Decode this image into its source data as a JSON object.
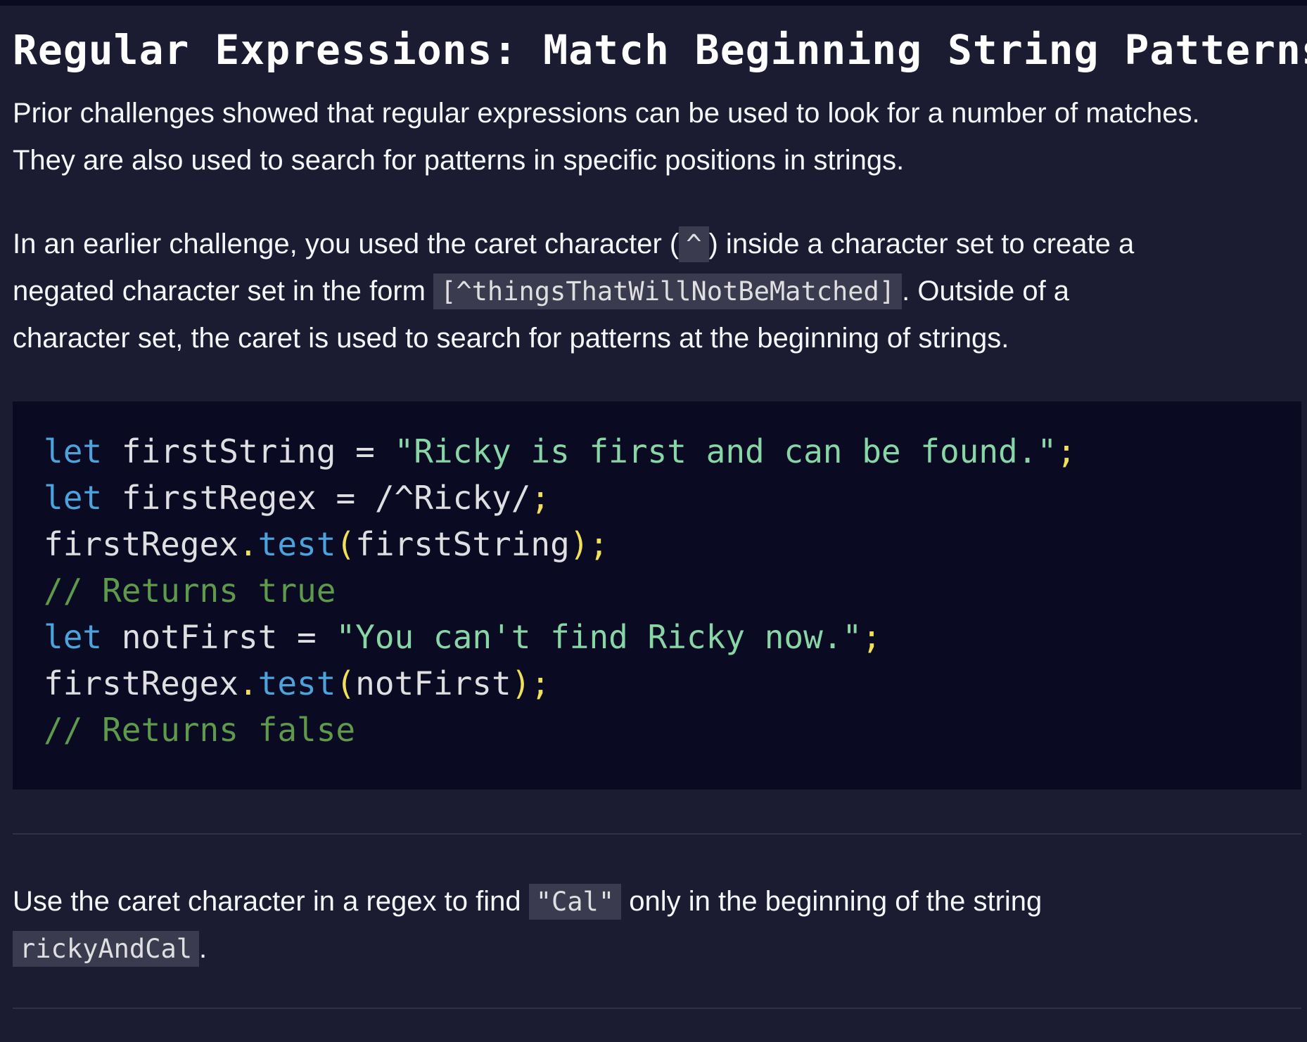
{
  "title": "Regular Expressions: Match Beginning String Patterns",
  "paragraph1": {
    "line1": "Prior challenges showed that regular expressions can be used to look for a number of matches.",
    "line2": "They are also used to search for patterns in specific positions in strings."
  },
  "paragraph2": {
    "seg1": "In an earlier challenge, you used the caret character (",
    "code1": "^",
    "seg2": ") inside a character set to create a",
    "seg3": "negated character set in the form ",
    "code2": "[^thingsThatWillNotBeMatched]",
    "seg4": ". Outside of a",
    "seg5": "character set, the caret is used to search for patterns at the beginning of strings."
  },
  "code_example": {
    "line1": {
      "kw": "let",
      "name": " firstString ",
      "op": "=",
      "str": "\"Ricky is first and can be found.\"",
      "end": ";"
    },
    "line2": {
      "kw": "let",
      "name": " firstRegex ",
      "op": "=",
      "rest": " /^Ricky/",
      "end": ";"
    },
    "line3": {
      "obj": "firstRegex",
      "dot": ".",
      "method": "test",
      "open": "(",
      "arg": "firstString",
      "close": ")",
      "end": ";"
    },
    "line4": "// Returns true",
    "line5": {
      "kw": "let",
      "name": " notFirst ",
      "op": "=",
      "str": "\"You can't find Ricky now.\"",
      "end": ";"
    },
    "line6": {
      "obj": "firstRegex",
      "dot": ".",
      "method": "test",
      "open": "(",
      "arg": "notFirst",
      "close": ")",
      "end": ";"
    },
    "line7": "// Returns false"
  },
  "instructions": {
    "seg1": "Use the caret character in a regex to find ",
    "code1": "\"Cal\"",
    "seg2": " only in the beginning of the string",
    "code2": "rickyAndCal",
    "seg3": "."
  },
  "colors": {
    "background": "#1b1b32",
    "code_background": "#0a0a23",
    "keyword": "#4ca3dc",
    "string": "#88d6a6",
    "comment": "#5f9a4c",
    "punctuation": "#f1e05a"
  }
}
